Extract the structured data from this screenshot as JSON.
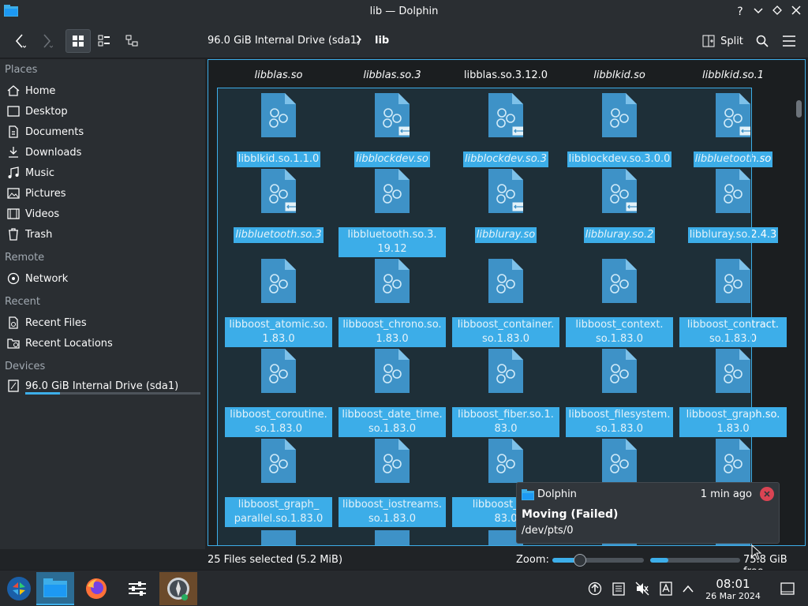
{
  "window": {
    "title": "lib — Dolphin"
  },
  "toolbar": {
    "breadcrumb": [
      "96.0 GiB Internal Drive (sda1)",
      "lib"
    ],
    "split_label": "Split"
  },
  "sidebar": {
    "places_label": "Places",
    "places": [
      "Home",
      "Desktop",
      "Documents",
      "Downloads",
      "Music",
      "Pictures",
      "Videos",
      "Trash"
    ],
    "remote_label": "Remote",
    "remote": [
      "Network"
    ],
    "recent_label": "Recent",
    "recent": [
      "Recent Files",
      "Recent Locations"
    ],
    "devices_label": "Devices",
    "devices": [
      "96.0 GiB Internal Drive (sda1)"
    ],
    "drive_usage_fraction": 0.2
  },
  "files": {
    "top_row": [
      "libblas.so",
      "libblas.so.3",
      "libblas.so.3.12.0",
      "libblkid.so",
      "libblkid.so.1"
    ],
    "grid": [
      [
        {
          "l1": "libblkid.so.1.1.0",
          "l2": "",
          "link": false
        },
        {
          "l1": "libblockdev.so",
          "l2": "",
          "link": true
        },
        {
          "l1": "libblockdev.so.3",
          "l2": "",
          "link": true
        },
        {
          "l1": "libblockdev.so.3.0.0",
          "l2": "",
          "link": false
        },
        {
          "l1": "libbluetooth.so",
          "l2": "",
          "link": true
        }
      ],
      [
        {
          "l1": "libbluetooth.so.3",
          "l2": "",
          "link": true
        },
        {
          "l1": "libbluetooth.so.3.",
          "l2": "19.12",
          "link": false
        },
        {
          "l1": "libbluray.so",
          "l2": "",
          "link": true
        },
        {
          "l1": "libbluray.so.2",
          "l2": "",
          "link": true
        },
        {
          "l1": "libbluray.so.2.4.3",
          "l2": "",
          "link": false
        }
      ],
      [
        {
          "l1": "libboost_atomic.so.",
          "l2": "1.83.0",
          "link": false
        },
        {
          "l1": "libboost_chrono.so.",
          "l2": "1.83.0",
          "link": false
        },
        {
          "l1": "libboost_container.",
          "l2": "so.1.83.0",
          "link": false
        },
        {
          "l1": "libboost_context.",
          "l2": "so.1.83.0",
          "link": false
        },
        {
          "l1": "libboost_contract.",
          "l2": "so.1.83.0",
          "link": false
        }
      ],
      [
        {
          "l1": "libboost_coroutine.",
          "l2": "so.1.83.0",
          "link": false
        },
        {
          "l1": "libboost_date_time.",
          "l2": "so.1.83.0",
          "link": false
        },
        {
          "l1": "libboost_fiber.so.1.",
          "l2": "83.0",
          "link": false
        },
        {
          "l1": "libboost_filesystem.",
          "l2": "so.1.83.0",
          "link": false
        },
        {
          "l1": "libboost_graph.so.",
          "l2": "1.83.0",
          "link": false
        }
      ],
      [
        {
          "l1": "libboost_graph_",
          "l2": "parallel.so.1.83.0",
          "link": false
        },
        {
          "l1": "libboost_iostreams.",
          "l2": "so.1.83.0",
          "link": false
        },
        {
          "l1": "libboost_json",
          "l2": "83.0",
          "link": false
        },
        {
          "l1": "",
          "l2": "",
          "link": false
        },
        {
          "l1": "",
          "l2": "",
          "link": false
        }
      ]
    ]
  },
  "statusbar": {
    "selection": "25 Files selected (5.2 MiB)",
    "zoom_label": "Zoom:",
    "free": "75.8 GiB free",
    "zoom_fraction": 0.3,
    "space_fraction": 0.2
  },
  "notification": {
    "app": "Dolphin",
    "time": "1 min ago",
    "title": "Moving (Failed)",
    "body": "/dev/pts/0"
  },
  "taskbar": {
    "time": "08:01",
    "date": "26 Mar 2024"
  },
  "colors": {
    "accent": "#3daee9",
    "window_bg": "#2a2e32",
    "view_bg": "#1b1e20",
    "error": "#da4453"
  }
}
